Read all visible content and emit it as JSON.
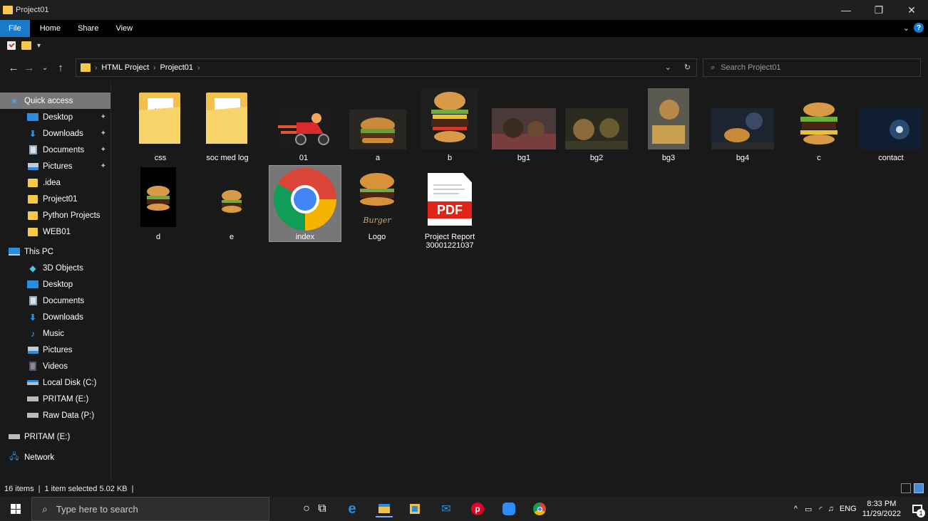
{
  "window": {
    "title": "Project01",
    "controls": [
      "—",
      "❐",
      "✕"
    ]
  },
  "ribbon": {
    "tabs": [
      "File",
      "Home",
      "Share",
      "View"
    ]
  },
  "nav": {
    "breadcrumb": [
      "HTML Project",
      "Project01"
    ],
    "search_placeholder": "Search Project01"
  },
  "sidebar": {
    "quick_access": "Quick access",
    "qa_items": [
      "Desktop",
      "Downloads",
      "Documents",
      "Pictures",
      ".idea",
      "Project01",
      "Python Projects",
      "WEB01"
    ],
    "this_pc": "This PC",
    "pc_items": [
      "3D Objects",
      "Desktop",
      "Documents",
      "Downloads",
      "Music",
      "Pictures",
      "Videos",
      "Local Disk (C:)",
      "PRITAM (E:)",
      "Raw Data (P:)"
    ],
    "drive": "PRITAM (E:)",
    "network": "Network"
  },
  "files": [
    {
      "name": "css",
      "kind": "folder"
    },
    {
      "name": "soc med log",
      "kind": "folder"
    },
    {
      "name": "01",
      "kind": "image"
    },
    {
      "name": "a",
      "kind": "image"
    },
    {
      "name": "b",
      "kind": "image"
    },
    {
      "name": "bg1",
      "kind": "image"
    },
    {
      "name": "bg2",
      "kind": "image"
    },
    {
      "name": "bg3",
      "kind": "image"
    },
    {
      "name": "bg4",
      "kind": "image"
    },
    {
      "name": "c",
      "kind": "image"
    },
    {
      "name": "contact",
      "kind": "image"
    },
    {
      "name": "d",
      "kind": "image"
    },
    {
      "name": "e",
      "kind": "image"
    },
    {
      "name": "index",
      "kind": "chrome-html",
      "selected": true
    },
    {
      "name": "Logo",
      "kind": "image"
    },
    {
      "name": "Project Report",
      "name2": "30001221037",
      "kind": "pdf"
    }
  ],
  "logo_text": "Burger",
  "pdf_text": "PDF",
  "status": {
    "items": "16 items",
    "selection": "1 item selected  5.02 KB"
  },
  "taskbar": {
    "search_placeholder": "Type here to search",
    "lang": "ENG",
    "time": "8:33 PM",
    "date": "11/29/2022",
    "notif_count": "1"
  },
  "colors": {
    "accent": "#1979ca",
    "folder": "#f2c14d",
    "selected": "#777777"
  }
}
